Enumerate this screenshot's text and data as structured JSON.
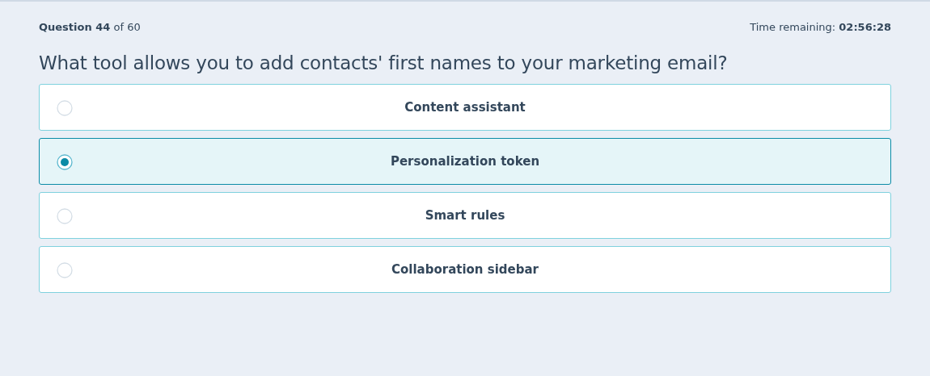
{
  "progress": {
    "text": "**Question 44** of 60"
  },
  "timer": {
    "text": "Time remaining: **02:56:28**"
  },
  "question": "What tool allows you to add contacts' first names to your marketing email?",
  "options": [
    {
      "label": "Content assistant",
      "selected": false
    },
    {
      "label": "Personalization token",
      "selected": true
    },
    {
      "label": "Smart rules",
      "selected": false
    },
    {
      "label": "Collaboration sidebar",
      "selected": false
    }
  ]
}
